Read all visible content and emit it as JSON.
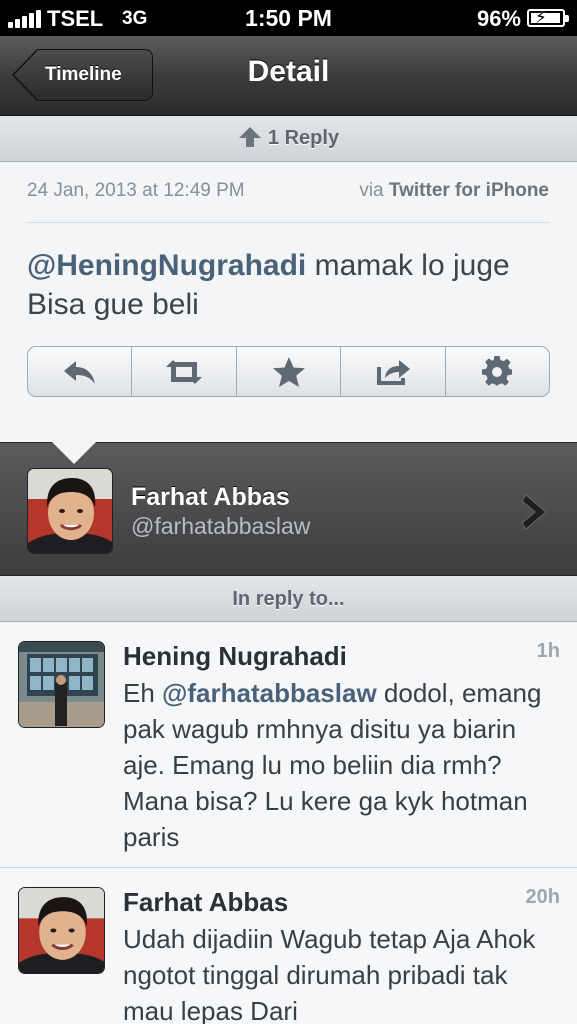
{
  "status_bar": {
    "carrier": "TSEL",
    "network": "3G",
    "time": "1:50 PM",
    "battery": "96%",
    "battery_level": 0.96
  },
  "nav": {
    "back_label": "Timeline",
    "title": "Detail"
  },
  "reply_bar": {
    "label": "1 Reply"
  },
  "tweet": {
    "date": "24 Jan, 2013 at 12:49 PM",
    "via_prefix": "via",
    "via_app": "Twitter for iPhone",
    "mention": "@HeningNugrahadi",
    "body": " mamak lo juge Bisa gue beli",
    "actions": [
      "reply-icon",
      "retweet-icon",
      "favorite-star-icon",
      "share-icon",
      "gear-icon"
    ]
  },
  "author": {
    "name": "Farhat Abbas",
    "handle": "@farhatabbaslaw"
  },
  "in_reply_to": {
    "label": "In reply to..."
  },
  "replies": [
    {
      "name": "Hening Nugrahadi",
      "age": "1h",
      "text_before": "Eh ",
      "mention": "@farhatabbaslaw",
      "text_after": " dodol, emang pak wagub rmhnya disitu ya biarin aje. Emang lu mo beliin dia rmh? Mana bisa? Lu kere ga kyk hotman paris"
    },
    {
      "name": "Farhat Abbas",
      "age": "20h",
      "text_before": "Udah dijadiin Wagub tetap Aja Ahok ngotot tinggal dirumah pribadi tak mau lepas Dari",
      "mention": "",
      "text_after": ""
    }
  ],
  "colors": {
    "mention": "#4a6279",
    "navbar": "#3b3c3e",
    "background": "#f4f5f6"
  }
}
